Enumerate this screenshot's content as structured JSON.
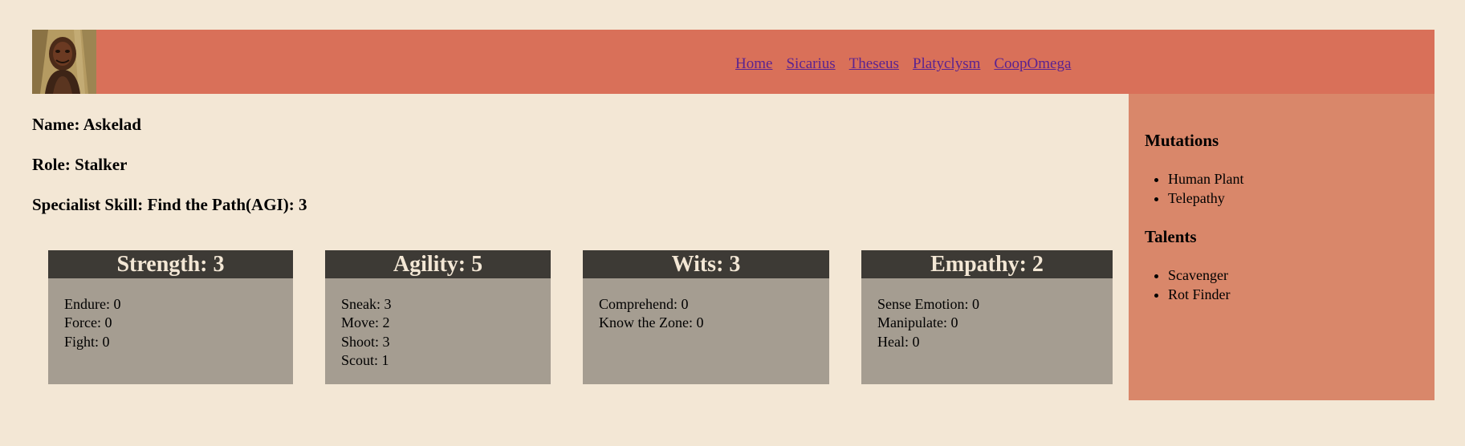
{
  "nav": {
    "links": [
      "Home",
      "Sicarius",
      "Theseus",
      "Platyclysm",
      "CoopOmega"
    ]
  },
  "character": {
    "name": "Name: Askelad",
    "role": "Role: Stalker",
    "specialist_skill": "Specialist Skill: Find the Path(AGI): 3"
  },
  "attributes": [
    {
      "title": "Strength: 3",
      "skills": [
        "Endure: 0",
        "Force: 0",
        "Fight: 0"
      ]
    },
    {
      "title": "Agility: 5",
      "skills": [
        "Sneak: 3",
        "Move: 2",
        "Shoot: 3",
        "Scout: 1"
      ]
    },
    {
      "title": "Wits: 3",
      "skills": [
        "Comprehend: 0",
        "Know the Zone: 0"
      ]
    },
    {
      "title": "Empathy: 2",
      "skills": [
        "Sense Emotion: 0",
        "Manipulate: 0",
        "Heal: 0"
      ]
    }
  ],
  "sidebar": {
    "mutations_heading": "Mutations",
    "mutations": [
      "Human Plant",
      "Telepathy"
    ],
    "talents_heading": "Talents",
    "talents": [
      "Scavenger",
      "Rot Finder"
    ]
  },
  "colors": {
    "page_bg": "#f3e7d5",
    "header_bg": "#d97059",
    "sidebar_bg": "#d9876a",
    "attr_head_bg": "#3d3a35",
    "attr_body_bg": "#a59d91",
    "link": "#5b2390"
  }
}
